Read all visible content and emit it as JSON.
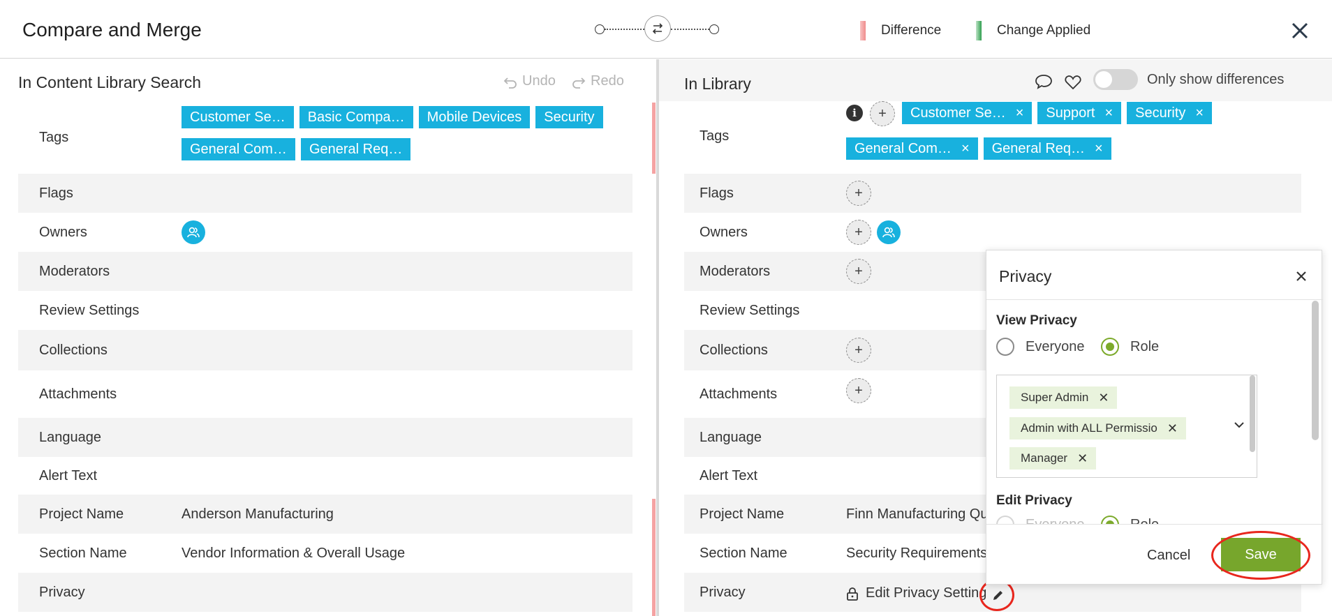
{
  "header": {
    "title": "Compare and Merge",
    "legend_difference": "Difference",
    "legend_change_applied": "Change Applied"
  },
  "colors": {
    "difference": "#f5a3a3",
    "change_applied": "#2f9e4f",
    "tag": "#18b1de",
    "save": "#77a62c",
    "chip": "#e9f3dd"
  },
  "left": {
    "title": "In Content Library Search",
    "undo": "Undo",
    "redo": "Redo",
    "rows": {
      "tags": "Tags",
      "flags": "Flags",
      "owners": "Owners",
      "moderators": "Moderators",
      "review_settings": "Review Settings",
      "collections": "Collections",
      "attachments": "Attachments",
      "language": "Language",
      "alert_text": "Alert Text",
      "project_name": "Project Name",
      "section_name": "Section Name",
      "privacy": "Privacy"
    },
    "tags": [
      "Customer Se…",
      "Basic Compa…",
      "Mobile Devices",
      "Security",
      "General Com…",
      "General Req…"
    ],
    "project_name": "Anderson Manufacturing",
    "section_name": "Vendor Information & Overall Usage"
  },
  "right": {
    "title": "In Library",
    "only_show_differences": "Only show differences",
    "rows": {
      "tags": "Tags",
      "flags": "Flags",
      "owners": "Owners",
      "moderators": "Moderators",
      "review_settings": "Review Settings",
      "collections": "Collections",
      "attachments": "Attachments",
      "language": "Language",
      "alert_text": "Alert Text",
      "project_name": "Project Name",
      "section_name": "Section Name",
      "privacy": "Privacy"
    },
    "tags": [
      "Customer Se…",
      "Support",
      "Security",
      "General Com…",
      "General Req…"
    ],
    "project_name": "Finn Manufacturing Qu",
    "section_name": "Security Requirements",
    "privacy_link": "Edit Privacy Setting"
  },
  "privacy_popup": {
    "title": "Privacy",
    "view_privacy": "View Privacy",
    "edit_privacy": "Edit Privacy",
    "everyone": "Everyone",
    "role": "Role",
    "selected_roles": [
      "Super Admin",
      "Admin with ALL Permissio",
      "Manager"
    ],
    "cancel": "Cancel",
    "save": "Save"
  }
}
